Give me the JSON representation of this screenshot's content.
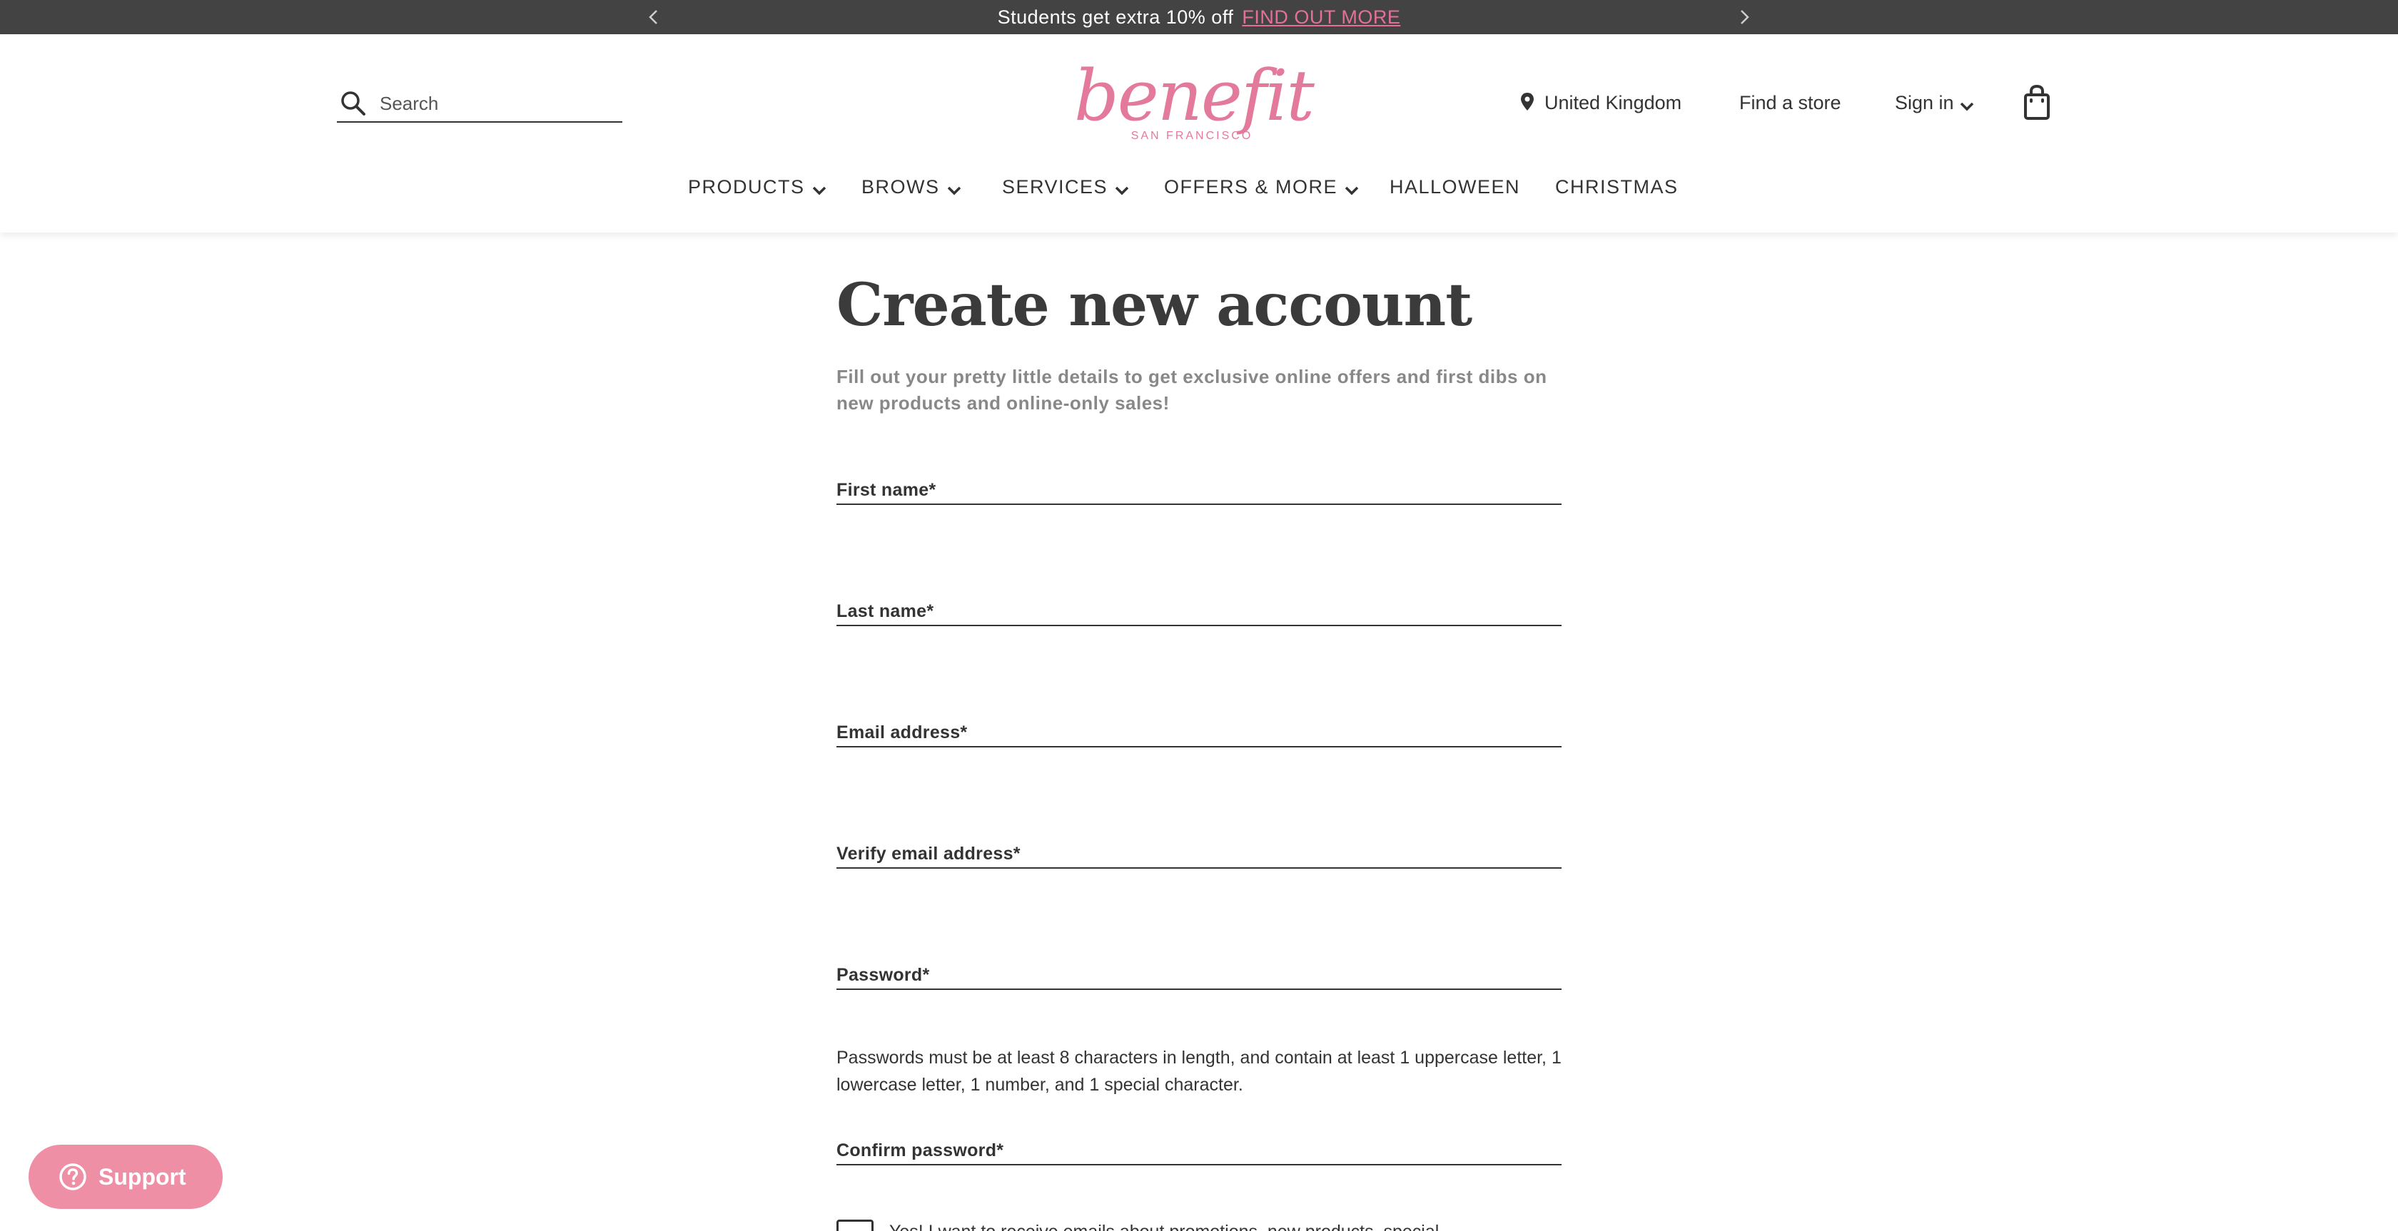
{
  "promo": {
    "text": "Students get extra 10% off",
    "link": "FIND OUT MORE",
    "prev_icon": "chevron-left-icon",
    "next_icon": "chevron-right-icon"
  },
  "header": {
    "search_placeholder": "Search",
    "logo_word": "benefit",
    "logo_sub": "SAN FRANCISCO",
    "country": "United Kingdom",
    "find_store": "Find a store",
    "sign_in": "Sign in"
  },
  "nav": {
    "items": [
      {
        "label": "PRODUCTS",
        "dropdown": true
      },
      {
        "label": "BROWS",
        "dropdown": true
      },
      {
        "label": "SERVICES",
        "dropdown": true
      },
      {
        "label": "OFFERS & MORE",
        "dropdown": true
      },
      {
        "label": "HALLOWEEN",
        "dropdown": false
      },
      {
        "label": "CHRISTMAS",
        "dropdown": false
      }
    ]
  },
  "form": {
    "title": "Create new account",
    "intro": "Fill out your pretty little details to get exclusive online offers and first dibs on new products and online-only sales!",
    "fields": [
      {
        "label": "First name*"
      },
      {
        "label": "Last name*"
      },
      {
        "label": "Email address*"
      },
      {
        "label": "Verify email address*"
      },
      {
        "label": "Password*"
      },
      {
        "label": "Confirm password*"
      }
    ],
    "password_hint": "Passwords must be at least 8 characters in length, and contain at least 1 uppercase letter, 1 lowercase letter, 1 number, and 1 special character.",
    "consent_text": "Yes! I want to receive emails about promotions, new products, special"
  },
  "support": {
    "label": "Support"
  },
  "colors": {
    "promo_bg": "#434343",
    "brand_pink": "#e47a9b",
    "support_bg": "#ef8fa6",
    "text": "#333333"
  }
}
